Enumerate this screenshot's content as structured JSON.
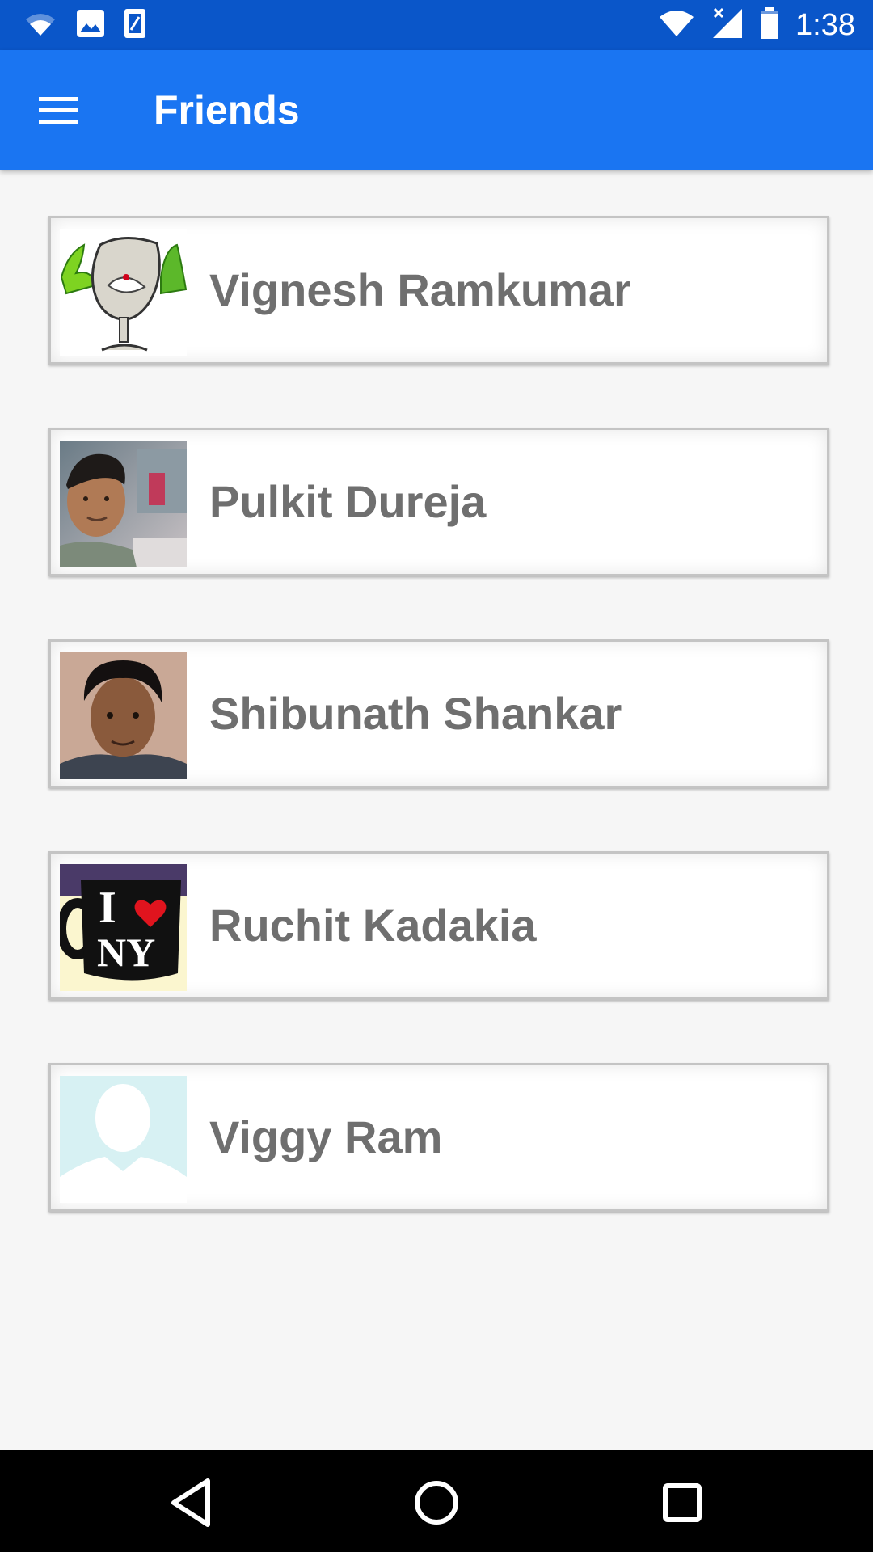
{
  "status_bar": {
    "time": "1:38",
    "icons": [
      "wifi-icon",
      "image-notification-icon",
      "sim-card-icon",
      "wifi-icon",
      "cell-signal-icon",
      "battery-icon"
    ]
  },
  "app_bar": {
    "title": "Friends",
    "color": "#1a75f2",
    "menu_icon": "hamburger-menu-icon"
  },
  "friends": [
    {
      "name": "Vignesh Ramkumar",
      "avatar": "cartoon-goblet-avatar"
    },
    {
      "name": "Pulkit Dureja",
      "avatar": "selfie-photo-avatar"
    },
    {
      "name": "Shibunath Shankar",
      "avatar": "portrait-photo-avatar"
    },
    {
      "name": "Ruchit Kadakia",
      "avatar": "i-love-ny-mug-avatar",
      "avatar_text": "I ♥ NY"
    },
    {
      "name": "Viggy Ram",
      "avatar": "default-silhouette-avatar"
    }
  ],
  "nav_bar": {
    "buttons": [
      "back-icon",
      "home-icon",
      "recents-icon"
    ]
  }
}
